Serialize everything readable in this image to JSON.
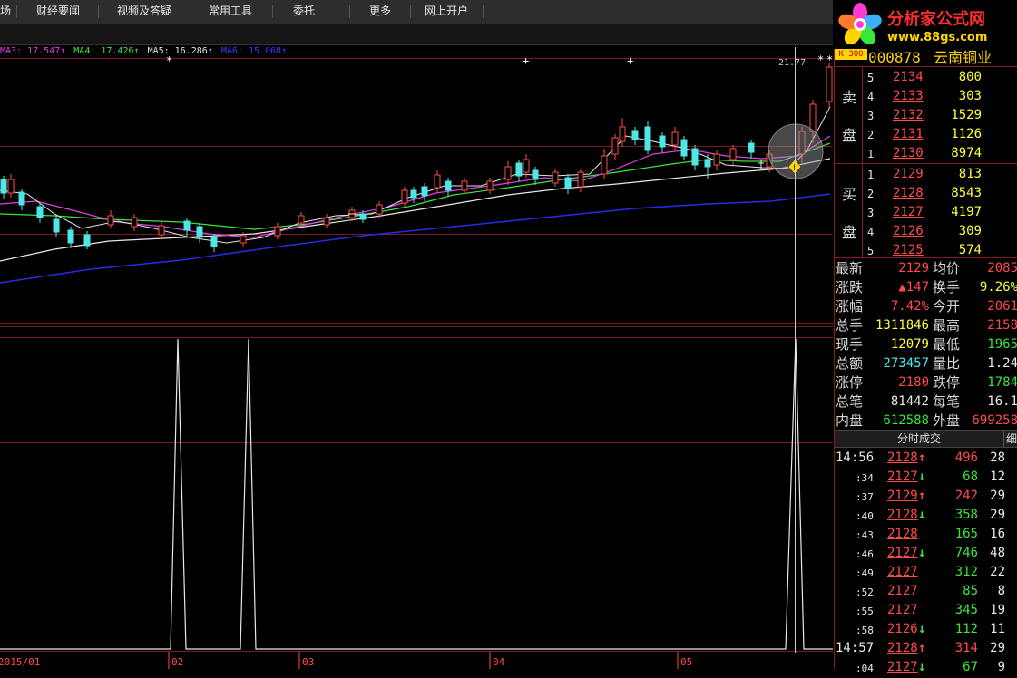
{
  "menu": {
    "items": [
      "场",
      "财经要闻",
      "视频及答疑",
      "常用工具",
      "委托",
      "更多",
      "网上开户"
    ]
  },
  "logo": {
    "title": "分析家公式网",
    "url": "www.88gs.com"
  },
  "ma_legend": [
    {
      "label": "MA3: 17.547↑",
      "color": "#e040e0"
    },
    {
      "label": "MA4: 17.426↑",
      "color": "#39e639"
    },
    {
      "label": "MA5: 16.286↑",
      "color": "#e8e8e8"
    },
    {
      "label": "MA6: 15.068↑",
      "color": "#3a3aff"
    }
  ],
  "chart": {
    "high_label": "21.77",
    "xaxis_labels": [
      "2015/01",
      "02",
      "03",
      "04",
      "05"
    ]
  },
  "stock": {
    "code": "000878",
    "name": "云南铜业",
    "corner": "K 300"
  },
  "sell": {
    "label1": "卖",
    "label2": "盘",
    "rows": [
      {
        "n": "5",
        "price": "2134",
        "vol": "800"
      },
      {
        "n": "4",
        "price": "2133",
        "vol": "303"
      },
      {
        "n": "3",
        "price": "2132",
        "vol": "1529"
      },
      {
        "n": "2",
        "price": "2131",
        "vol": "1126"
      },
      {
        "n": "1",
        "price": "2130",
        "vol": "8974"
      }
    ]
  },
  "buy": {
    "label1": "买",
    "label2": "盘",
    "rows": [
      {
        "n": "1",
        "price": "2129",
        "vol": "813"
      },
      {
        "n": "2",
        "price": "2128",
        "vol": "8543"
      },
      {
        "n": "3",
        "price": "2127",
        "vol": "4197"
      },
      {
        "n": "4",
        "price": "2126",
        "vol": "309"
      },
      {
        "n": "5",
        "price": "2125",
        "vol": "574"
      }
    ]
  },
  "stats": [
    {
      "l1": "最新",
      "v1": "2129",
      "c1": "red",
      "l2": "均价",
      "v2": "2085",
      "c2": "red"
    },
    {
      "l1": "涨跌",
      "v1": "▲147",
      "c1": "red",
      "l2": "换手",
      "v2": "9.26%",
      "c2": "yellow"
    },
    {
      "l1": "涨幅",
      "v1": "7.42%",
      "c1": "red",
      "l2": "今开",
      "v2": "2061",
      "c2": "red"
    },
    {
      "l1": "总手",
      "v1": "1311846",
      "c1": "yellow",
      "l2": "最高",
      "v2": "2158",
      "c2": "red"
    },
    {
      "l1": "现手",
      "v1": "12079",
      "c1": "yellow",
      "l2": "最低",
      "v2": "1965",
      "c2": "green"
    },
    {
      "l1": "总额",
      "v1": "273457",
      "c1": "cyan",
      "l2": "量比",
      "v2": "1.24",
      "c2": "white"
    },
    {
      "l1": "涨停",
      "v1": "2180",
      "c1": "red",
      "l2": "跌停",
      "v2": "1784",
      "c2": "green"
    },
    {
      "l1": "总笔",
      "v1": "81442",
      "c1": "white",
      "l2": "每笔",
      "v2": "16.1",
      "c2": "white"
    },
    {
      "l1": "内盘",
      "v1": "612588",
      "c1": "green",
      "l2": "外盘",
      "v2": "699258",
      "c2": "red"
    }
  ],
  "ticks_header": {
    "title": "分时成交",
    "detail": "细"
  },
  "ticks": [
    {
      "time": "14:56",
      "price": "2128",
      "arrow": "↑",
      "dir": "up",
      "vol": "496",
      "vc": "red",
      "cnt": "28"
    },
    {
      "time": ":34",
      "price": "2127",
      "arrow": "↓",
      "dir": "down",
      "vol": "68",
      "vc": "green",
      "cnt": "12"
    },
    {
      "time": ":37",
      "price": "2129",
      "arrow": "↑",
      "dir": "up",
      "vol": "242",
      "vc": "red",
      "cnt": "29"
    },
    {
      "time": ":40",
      "price": "2128",
      "arrow": "↓",
      "dir": "down",
      "vol": "358",
      "vc": "green",
      "cnt": "29"
    },
    {
      "time": ":43",
      "price": "2128",
      "arrow": "",
      "dir": "none",
      "vol": "165",
      "vc": "green",
      "cnt": "16"
    },
    {
      "time": ":46",
      "price": "2127",
      "arrow": "↓",
      "dir": "down",
      "vol": "746",
      "vc": "green",
      "cnt": "48"
    },
    {
      "time": ":49",
      "price": "2127",
      "arrow": "",
      "dir": "none",
      "vol": "312",
      "vc": "green",
      "cnt": "22"
    },
    {
      "time": ":52",
      "price": "2127",
      "arrow": "",
      "dir": "none",
      "vol": "85",
      "vc": "green",
      "cnt": "8"
    },
    {
      "time": ":55",
      "price": "2127",
      "arrow": "",
      "dir": "none",
      "vol": "345",
      "vc": "green",
      "cnt": "19"
    },
    {
      "time": ":58",
      "price": "2126",
      "arrow": "↓",
      "dir": "down",
      "vol": "112",
      "vc": "green",
      "cnt": "11"
    },
    {
      "time": "14:57",
      "price": "2128",
      "arrow": "↑",
      "dir": "up",
      "vol": "314",
      "vc": "red",
      "cnt": "29"
    },
    {
      "time": ":04",
      "price": "2127",
      "arrow": "↓",
      "dir": "down",
      "vol": "67",
      "vc": "green",
      "cnt": "9"
    }
  ]
}
